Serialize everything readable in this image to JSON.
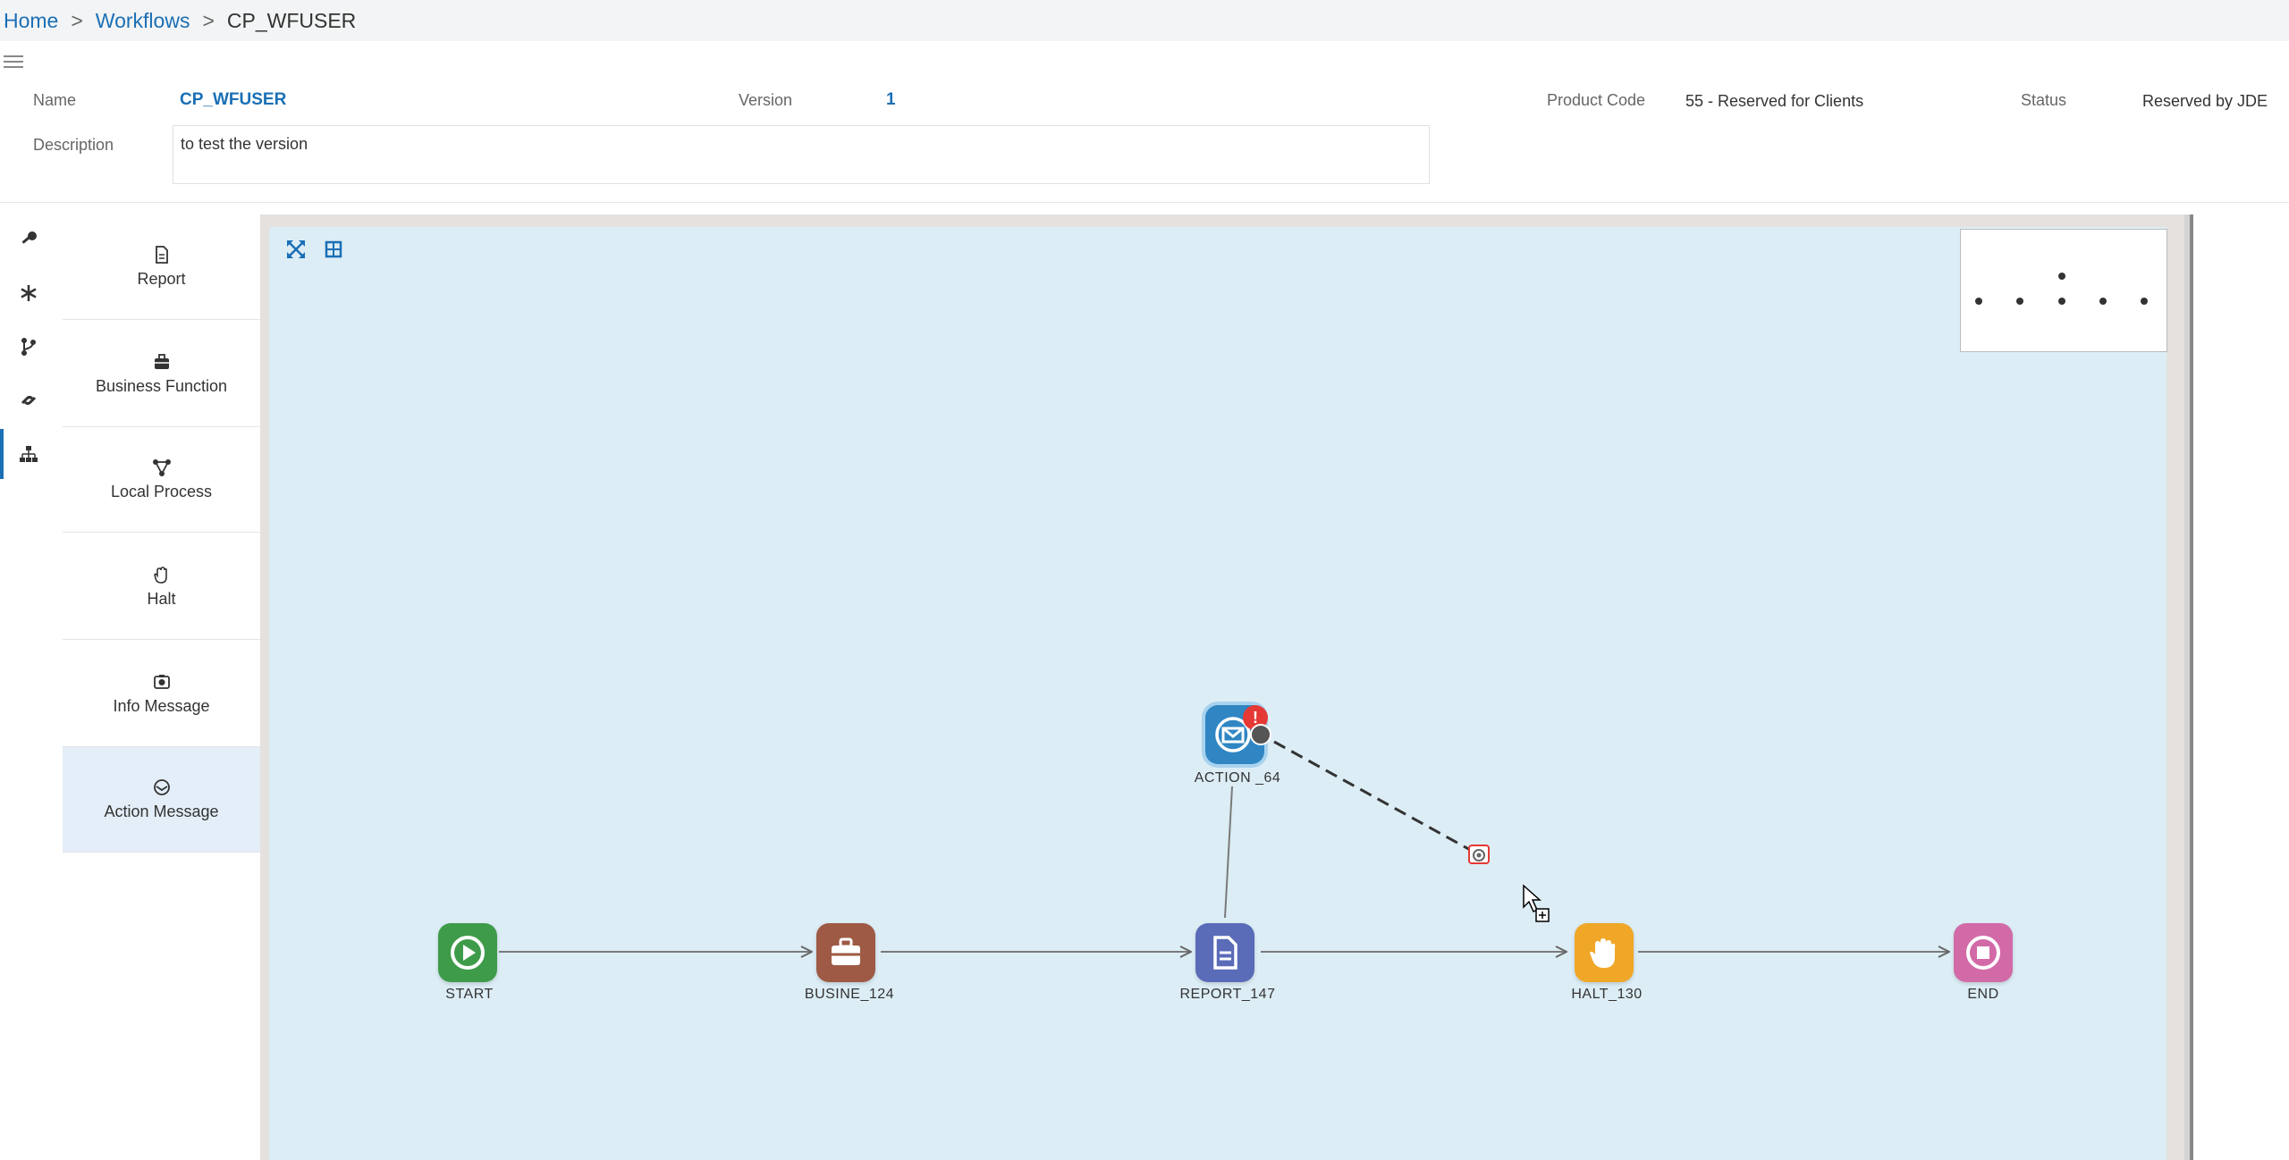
{
  "breadcrumb": {
    "home": "Home",
    "workflows": "Workflows",
    "current": "CP_WFUSER",
    "separator": ">"
  },
  "form": {
    "name_label": "Name",
    "name_value": "CP_WFUSER",
    "version_label": "Version",
    "version_value": "1",
    "product_code_label": "Product Code",
    "product_code_value": "55 - Reserved for Clients",
    "status_label": "Status",
    "status_value": "Reserved by JDE",
    "description_label": "Description",
    "description_value": "to test the version"
  },
  "rail_icons": [
    "key-icon",
    "asterisk-icon",
    "branch-icon",
    "link-icon",
    "hierarchy-icon"
  ],
  "palette": [
    {
      "label": "Report",
      "icon": "report-icon"
    },
    {
      "label": "Business Function",
      "icon": "briefcase-icon"
    },
    {
      "label": "Local Process",
      "icon": "process-icon"
    },
    {
      "label": "Halt",
      "icon": "hand-icon"
    },
    {
      "label": "Info Message",
      "icon": "info-message-icon"
    },
    {
      "label": "Action Message",
      "icon": "action-message-icon"
    }
  ],
  "nodes": [
    {
      "id": "start",
      "label": "START",
      "color": "#3e9b4a"
    },
    {
      "id": "busine",
      "label": "BUSINE_124",
      "color": "#9e5a44"
    },
    {
      "id": "report",
      "label": "REPORT_147",
      "color": "#5a6bb8"
    },
    {
      "id": "halt",
      "label": "HALT_130",
      "color": "#f0a728"
    },
    {
      "id": "end",
      "label": "END",
      "color": "#d36aa8"
    },
    {
      "id": "action",
      "label": "ACTION _64",
      "color": "#2f86c3"
    }
  ],
  "colors": {
    "link": "#1a6fb5",
    "canvas": "#dcedf5",
    "selected": "#e4eef8",
    "badge": "#e53935"
  }
}
